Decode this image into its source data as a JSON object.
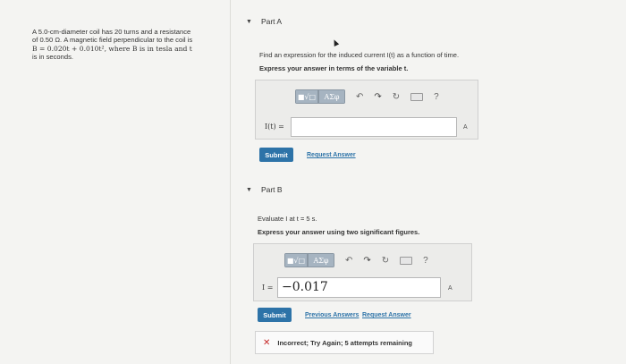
{
  "problem": {
    "line1": "A 5.0-cm-diameter coil has 20 turns and a resistance",
    "line2": "of 0.50 Ω. A magnetic field perpendicular to the coil is",
    "line3": "B = 0.020t + 0.010t², where B is in tesla and t",
    "line4": "is in seconds."
  },
  "partA": {
    "title": "Part A",
    "prompt": "Find an expression for the induced current I(t) as a function of time.",
    "instruction": "Express your answer in terms of the variable t.",
    "toolbar": {
      "sqrt_label": "■√□",
      "greek_label": "ΑΣφ",
      "help_label": "?"
    },
    "input_label": "I(t) =",
    "input_value": "",
    "unit_label": "A",
    "submit_label": "Submit",
    "request_answer": "Request Answer"
  },
  "partB": {
    "title": "Part B",
    "prompt": "Evaluate I at t = 5 s.",
    "instruction": "Express your answer using two significant figures.",
    "toolbar": {
      "sqrt_label": "■√□",
      "greek_label": "ΑΣφ",
      "help_label": "?"
    },
    "input_label": "I =",
    "input_value": "−0.017",
    "unit_label": "A",
    "submit_label": "Submit",
    "previous_answers": "Previous Answers",
    "request_answer": "Request Answer",
    "feedback": "Incorrect; Try Again; 5 attempts remaining"
  }
}
